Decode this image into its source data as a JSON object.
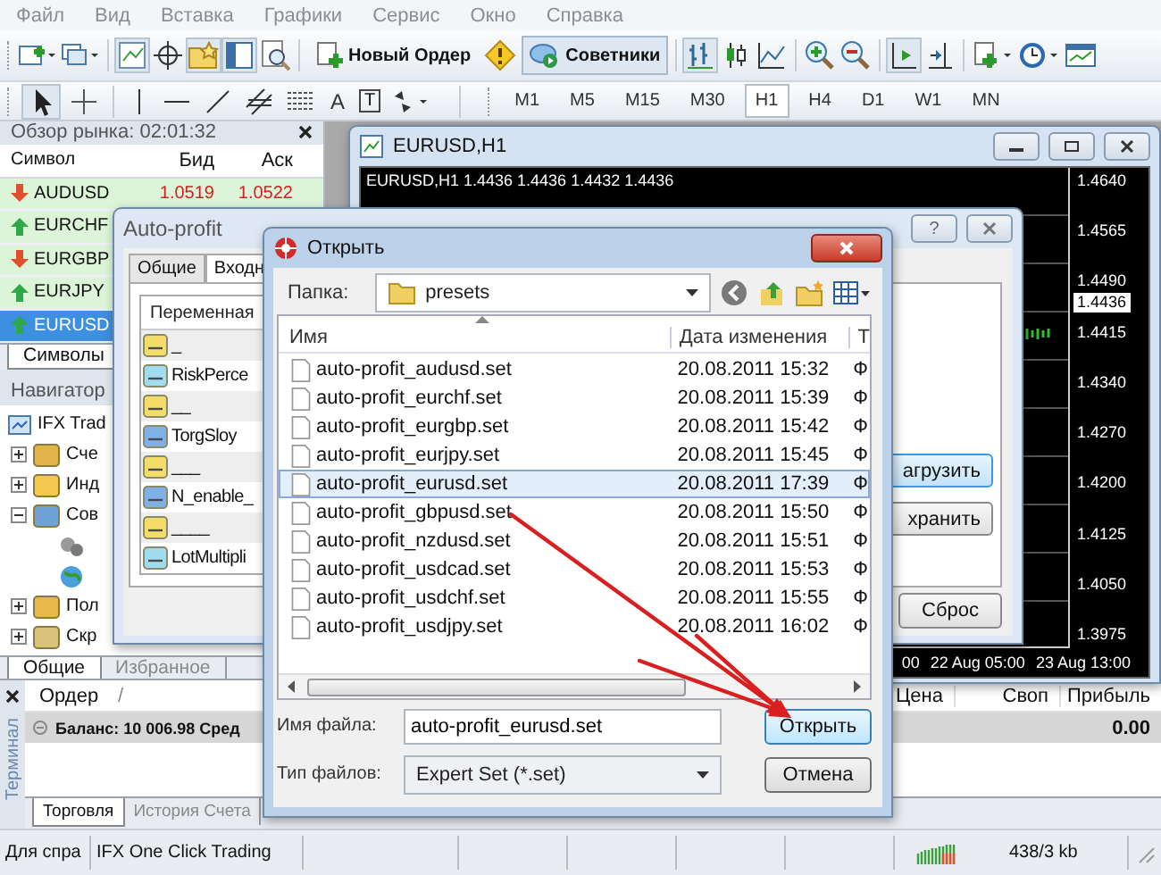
{
  "menu": [
    "Файл",
    "Вид",
    "Вставка",
    "Графики",
    "Сервис",
    "Окно",
    "Справка"
  ],
  "toolbar": {
    "new_order": "Новый Ордер",
    "experts": {
      "label": "Советники",
      "on": true
    }
  },
  "drawing_tools": {
    "text_tool": "A",
    "label_tool": "T"
  },
  "timeframes": [
    {
      "label": "M1",
      "selected": false
    },
    {
      "label": "M5",
      "selected": false
    },
    {
      "label": "M15",
      "selected": false
    },
    {
      "label": "M30",
      "selected": false
    },
    {
      "label": "H1",
      "selected": true
    },
    {
      "label": "H4",
      "selected": false
    },
    {
      "label": "D1",
      "selected": false
    },
    {
      "label": "W1",
      "selected": false
    },
    {
      "label": "MN",
      "selected": false
    }
  ],
  "market_watch": {
    "title": "Обзор рынка: 02:01:32",
    "columns": [
      "Символ",
      "Бид",
      "Аск"
    ],
    "rows": [
      {
        "symbol": "AUDUSD",
        "bid": "1.0519",
        "ask": "1.0522",
        "kind": "down",
        "selected": false
      },
      {
        "symbol": "EURCHF",
        "kind": "up",
        "selected": false
      },
      {
        "symbol": "EURGBP",
        "kind": "down",
        "selected": false
      },
      {
        "symbol": "EURJPY",
        "kind": "up",
        "selected": false
      },
      {
        "symbol": "EURUSD",
        "kind": "up",
        "selected": true
      }
    ],
    "tabs": [
      {
        "label": "Символы",
        "selected": true
      }
    ]
  },
  "navigator": {
    "title": "Навигатор",
    "tree": {
      "label": "IFX Trad",
      "children": [
        {
          "label": "Сче",
          "kind": "accounts",
          "expanded": false
        },
        {
          "label": "Инд",
          "kind": "indicators",
          "expanded": false
        },
        {
          "label": "Сов",
          "kind": "experts",
          "expanded": true,
          "children": [
            {
              "kind": "expert"
            },
            {
              "kind": "globe"
            }
          ]
        },
        {
          "label": "Пол",
          "kind": "custom",
          "expanded": false
        },
        {
          "label": "Скр",
          "kind": "scripts",
          "expanded": false
        }
      ]
    },
    "tabs": [
      {
        "label": "Общие",
        "selected": true
      },
      {
        "label": "Избранное",
        "selected": false
      }
    ]
  },
  "chart_window": {
    "title": "EURUSD,H1",
    "header": "EURUSD,H1  1.4436 1.4436 1.4432 1.4436",
    "prices": [
      "1.4640",
      "1.4565",
      "1.4490",
      "1.4415",
      "1.4340",
      "1.4270",
      "1.4200",
      "1.4125",
      "1.4050",
      "1.3975"
    ],
    "current_price": "1.4436",
    "times": [
      "00",
      "22 Aug 05:00",
      "23 Aug 13:00"
    ]
  },
  "expert_dialog": {
    "title": "Auto-profit",
    "help": "?",
    "tabs": [
      {
        "label": "Общие",
        "selected": false
      },
      {
        "label": "Входн",
        "selected": true
      }
    ],
    "column": "Переменная",
    "params": [
      {
        "name": "_",
        "kind": "string"
      },
      {
        "name": "RiskPerce",
        "kind": "double"
      },
      {
        "name": "__",
        "kind": "string"
      },
      {
        "name": "TorgSloy",
        "kind": "int"
      },
      {
        "name": "___",
        "kind": "string"
      },
      {
        "name": "N_enable_",
        "kind": "int"
      },
      {
        "name": "____",
        "kind": "string"
      },
      {
        "name": "LotMultipli",
        "kind": "double"
      }
    ],
    "side_buttons": [
      {
        "label": "агрузить",
        "focused": true
      },
      {
        "label": "хранить",
        "focused": false
      }
    ],
    "reset": "Сброс"
  },
  "open_dialog": {
    "title": "Открыть",
    "folder_label": "Папка:",
    "folder": "presets",
    "columns": [
      "Имя",
      "Дата изменения",
      "Т"
    ],
    "files": [
      {
        "name": "auto-profit_audusd.set",
        "date": "20.08.2011 15:32",
        "type": "Ф",
        "selected": false
      },
      {
        "name": "auto-profit_eurchf.set",
        "date": "20.08.2011 15:39",
        "type": "Ф",
        "selected": false
      },
      {
        "name": "auto-profit_eurgbp.set",
        "date": "20.08.2011 15:42",
        "type": "Ф",
        "selected": false
      },
      {
        "name": "auto-profit_eurjpy.set",
        "date": "20.08.2011 15:45",
        "type": "Ф",
        "selected": false
      },
      {
        "name": "auto-profit_eurusd.set",
        "date": "20.08.2011 17:39",
        "type": "Ф",
        "selected": true
      },
      {
        "name": "auto-profit_gbpusd.set",
        "date": "20.08.2011 15:50",
        "type": "Ф",
        "selected": false
      },
      {
        "name": "auto-profit_nzdusd.set",
        "date": "20.08.2011 15:51",
        "type": "Ф",
        "selected": false
      },
      {
        "name": "auto-profit_usdcad.set",
        "date": "20.08.2011 15:53",
        "type": "Ф",
        "selected": false
      },
      {
        "name": "auto-profit_usdchf.set",
        "date": "20.08.2011 15:55",
        "type": "Ф",
        "selected": false
      },
      {
        "name": "auto-profit_usdjpy.set",
        "date": "20.08.2011 16:02",
        "type": "Ф",
        "selected": false
      }
    ],
    "filename_label": "Имя файла:",
    "filename": "auto-profit_eurusd.set",
    "filetype_label": "Тип файлов:",
    "filetype": "Expert Set (*.set)",
    "buttons": [
      {
        "label": "Открыть",
        "kind": "primary"
      },
      {
        "label": "Отмена",
        "kind": "cancel"
      }
    ]
  },
  "terminal": {
    "title": "Терминал",
    "columns": [
      "Ордер",
      "/",
      "Цена",
      "Своп",
      "Прибыль"
    ],
    "balance": "Баланс: 10 006.98  Сред",
    "profit": "0.00",
    "tabs": [
      {
        "label": "Торговля",
        "selected": true
      },
      {
        "label": "История Счета",
        "selected": false
      }
    ]
  },
  "status_bar": {
    "help": "Для спра",
    "profile": "IFX One Click Trading",
    "traffic": "438/3 kb"
  }
}
